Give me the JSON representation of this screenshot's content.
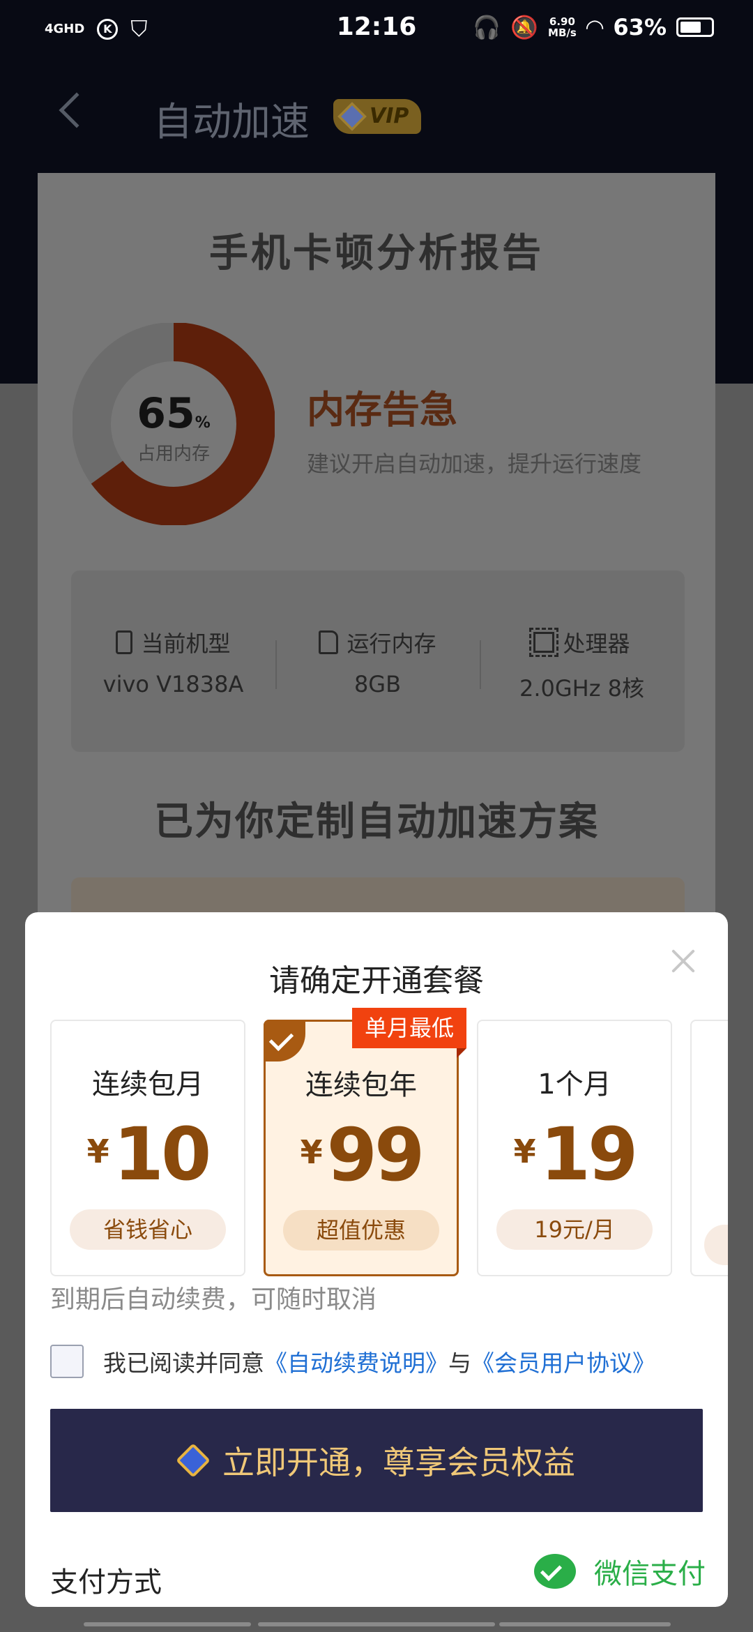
{
  "status_bar": {
    "network": "4GHD",
    "k_icon_letter": "K",
    "time": "12:16",
    "speed_value": "6.90",
    "speed_unit": "MB/s",
    "battery": "63%"
  },
  "header": {
    "title": "自动加速",
    "vip_badge": "VIP"
  },
  "report": {
    "title": "手机卡顿分析报告",
    "memory_percent": "65",
    "percent_sign": "%",
    "memory_label": "占用内存",
    "memory_fraction": 0.65,
    "alert_title": "内存告急",
    "alert_desc": "建议开启自动加速，提升运行速度",
    "specs": [
      {
        "label": "当前机型",
        "value": "vivo V1838A",
        "icon": "phone-icon"
      },
      {
        "label": "运行内存",
        "value": "8GB",
        "icon": "sd-card-icon"
      },
      {
        "label": "处理器",
        "value": "2.0GHz 8核",
        "icon": "chip-icon"
      }
    ],
    "plan_heading": "已为你定制自动加速方案"
  },
  "modal": {
    "title": "请确定开通套餐",
    "currency": "¥",
    "plans": [
      {
        "name": "连续包月",
        "price": "10",
        "tag": "省钱省心",
        "selected": false
      },
      {
        "name": "连续包年",
        "price": "99",
        "tag": "超值优惠",
        "selected": true,
        "ribbon": "单月最低"
      },
      {
        "name": "1个月",
        "price": "19",
        "tag": "19元/月",
        "selected": false
      }
    ],
    "renew_note": "到期后自动续费，可随时取消",
    "agree_text": "我已阅读并同意",
    "link_autorenew": "《自动续费说明》",
    "agree_and": "与",
    "link_agreement": "《会员用户协议》",
    "cta": "立即开通，尊享会员权益",
    "pay_label": "支付方式",
    "pay_method": "微信支付"
  },
  "colors": {
    "accent_brown": "#a85a12",
    "ribbon_red": "#f1420f",
    "cta_bg": "#28284a",
    "cta_text": "#f0c878",
    "link_blue": "#1f6fd4",
    "wechat_green": "#2aae48"
  }
}
